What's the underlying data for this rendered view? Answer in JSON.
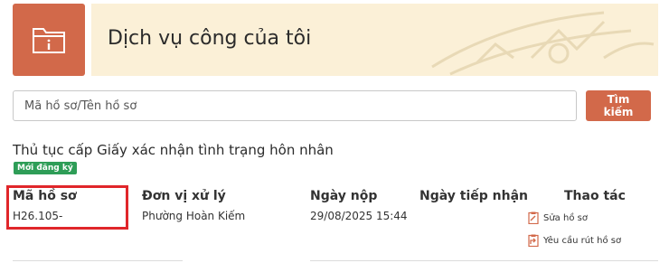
{
  "header": {
    "title": "Dịch vụ công của tôi",
    "icon": "folder-info-icon",
    "accent": "#d2694a",
    "banner_bg": "#fbf0d7"
  },
  "search": {
    "placeholder": "Mã hồ sơ/Tên hồ sơ",
    "button_label": "Tìm kiếm"
  },
  "procedure": {
    "title": "Thủ tục cấp Giấy xác nhận tình trạng hôn nhân",
    "badge": "Mới đăng ký",
    "badge_color": "#2e9d57"
  },
  "table": {
    "headers": [
      "Mã hồ sơ",
      "Đơn vị xử lý",
      "Ngày nộp",
      "Ngày tiếp nhận",
      "Thao tác"
    ],
    "row": {
      "code": "H26.105-",
      "unit": "Phường Hoàn Kiếm",
      "submitted": "29/08/2025 15:44",
      "received": ""
    },
    "actions": [
      {
        "label": "Sửa hồ sơ",
        "icon": "edit-document-icon"
      },
      {
        "label": "Yêu cầu rút hồ sơ",
        "icon": "withdraw-document-icon"
      }
    ]
  }
}
